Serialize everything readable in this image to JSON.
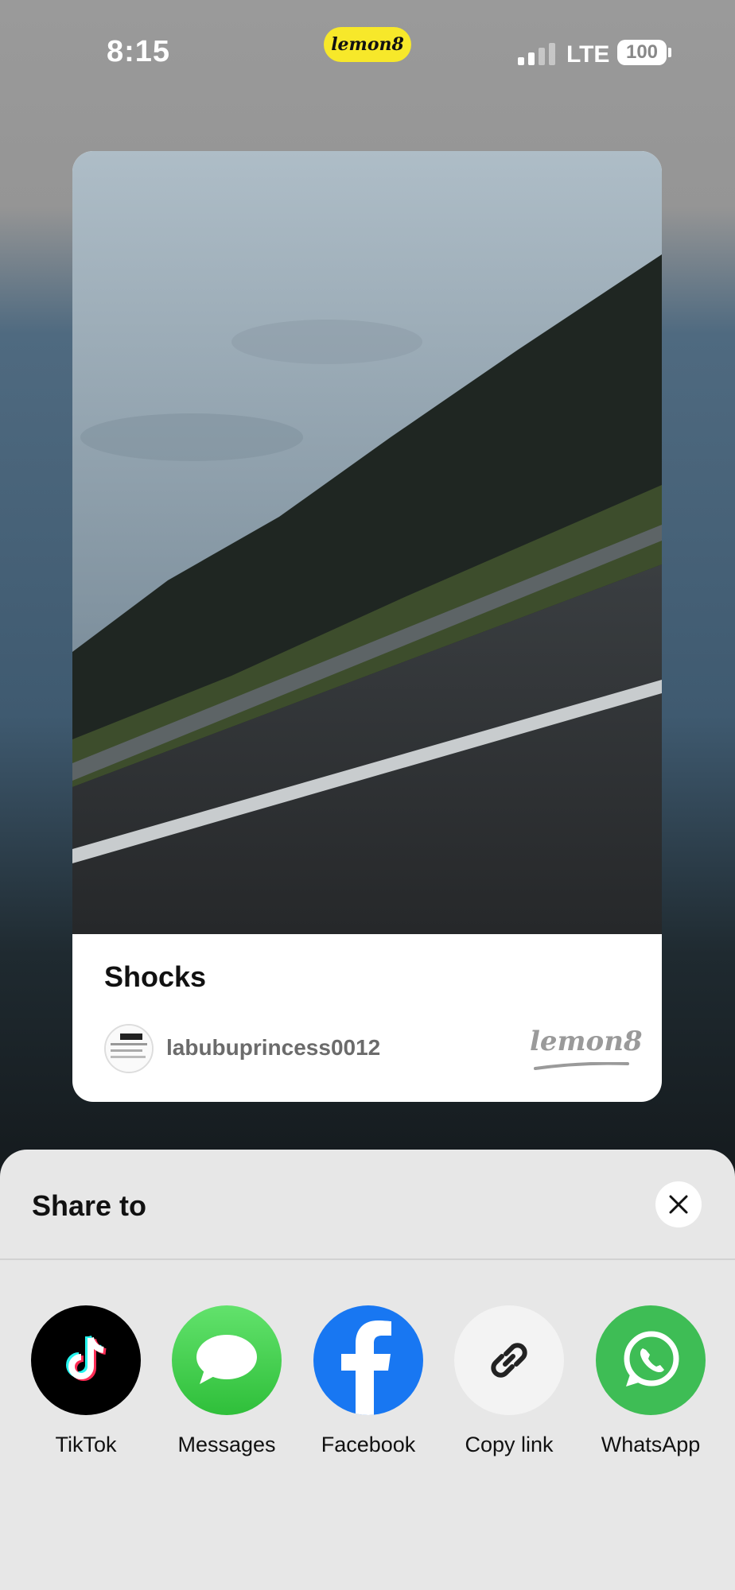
{
  "status_bar": {
    "time": "8:15",
    "app_pill": "lemon8",
    "network": "LTE",
    "battery": "100"
  },
  "post_card": {
    "title": "Shocks",
    "username": "labubuprincess0012",
    "brand": "lemon8"
  },
  "share_sheet": {
    "title": "Share to",
    "targets": [
      {
        "label": "TikTok",
        "icon": "tiktok-icon",
        "color": "#000000"
      },
      {
        "label": "Messages",
        "icon": "messages-icon",
        "color": "#34c759"
      },
      {
        "label": "Facebook",
        "icon": "facebook-icon",
        "color": "#1877f2"
      },
      {
        "label": "Copy link",
        "icon": "link-icon",
        "color": "#f3f3f3"
      },
      {
        "label": "WhatsApp",
        "icon": "whatsapp-icon",
        "color": "#3ebd55"
      }
    ]
  }
}
